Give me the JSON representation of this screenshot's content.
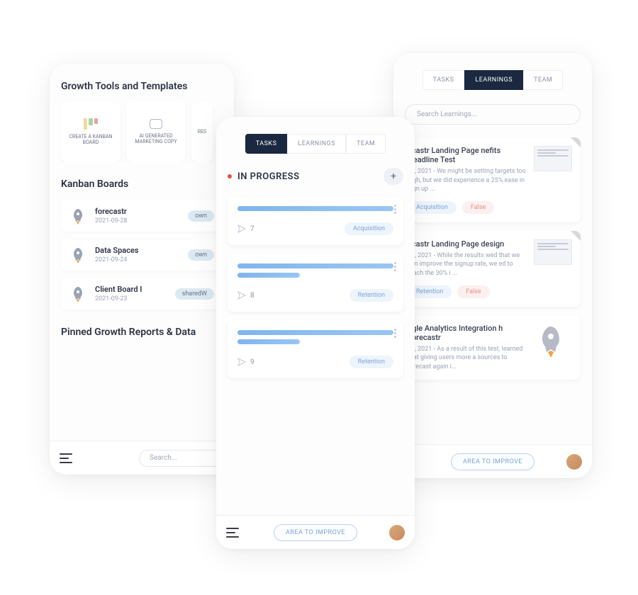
{
  "left": {
    "section1_title": "Growth Tools and Templates",
    "tools": [
      {
        "label": "CREATE A KANBAN BOARD"
      },
      {
        "label": "AI GENERATED MARKETING COPY"
      },
      {
        "label": "RES"
      }
    ],
    "section2_title": "Kanban Boards",
    "boards": [
      {
        "name": "forecastr",
        "date": "2021-09-28",
        "tag": "own"
      },
      {
        "name": "Data Spaces",
        "date": "2021-09-24",
        "tag": "own"
      },
      {
        "name": "Client Board I",
        "date": "2021-09-23",
        "tag": "sharedW"
      }
    ],
    "section3_title": "Pinned Growth Reports & Data",
    "search_placeholder": "Search..."
  },
  "center": {
    "tabs": [
      {
        "label": "TASKS",
        "active": true
      },
      {
        "label": "LEARNINGS",
        "active": false
      },
      {
        "label": "TEAM",
        "active": false
      }
    ],
    "column_title": "IN PROGRESS",
    "tasks": [
      {
        "count": "7",
        "category": "Acquisition"
      },
      {
        "count": "8",
        "category": "Retention"
      },
      {
        "count": "9",
        "category": "Retention"
      }
    ],
    "area_btn": "AREA TO IMPROVE"
  },
  "right": {
    "tabs": [
      {
        "label": "TASKS",
        "active": false
      },
      {
        "label": "LEARNINGS",
        "active": true
      },
      {
        "label": "TEAM",
        "active": false
      }
    ],
    "search_placeholder": "Search Learnings...",
    "learnings": [
      {
        "title": "ecastr Landing Page nefits Headline Test",
        "text": "05, 2021 - We might be setting targets too high, but we did experience a 25% ease in sign up ...",
        "tags": [
          {
            "label": "Acquisition",
            "kind": "blue"
          },
          {
            "label": "False",
            "kind": "red"
          }
        ],
        "thumb": true
      },
      {
        "title": "ecastr Landing Page design",
        "text": "05, 2021 - While the results wed that we can improve the signup rate, we ed to reach the 30% i ...",
        "tags": [
          {
            "label": "Retention",
            "kind": "blue"
          },
          {
            "label": "False",
            "kind": "red"
          }
        ],
        "thumb": true
      },
      {
        "title": "ogle Analytics Integration h Forecastr",
        "text": "29, 2021 - As a result of this test, learned that giving users more a sources to forecast again i...",
        "tags": [],
        "rocket": true
      }
    ],
    "area_btn": "AREA TO IMPROVE"
  }
}
